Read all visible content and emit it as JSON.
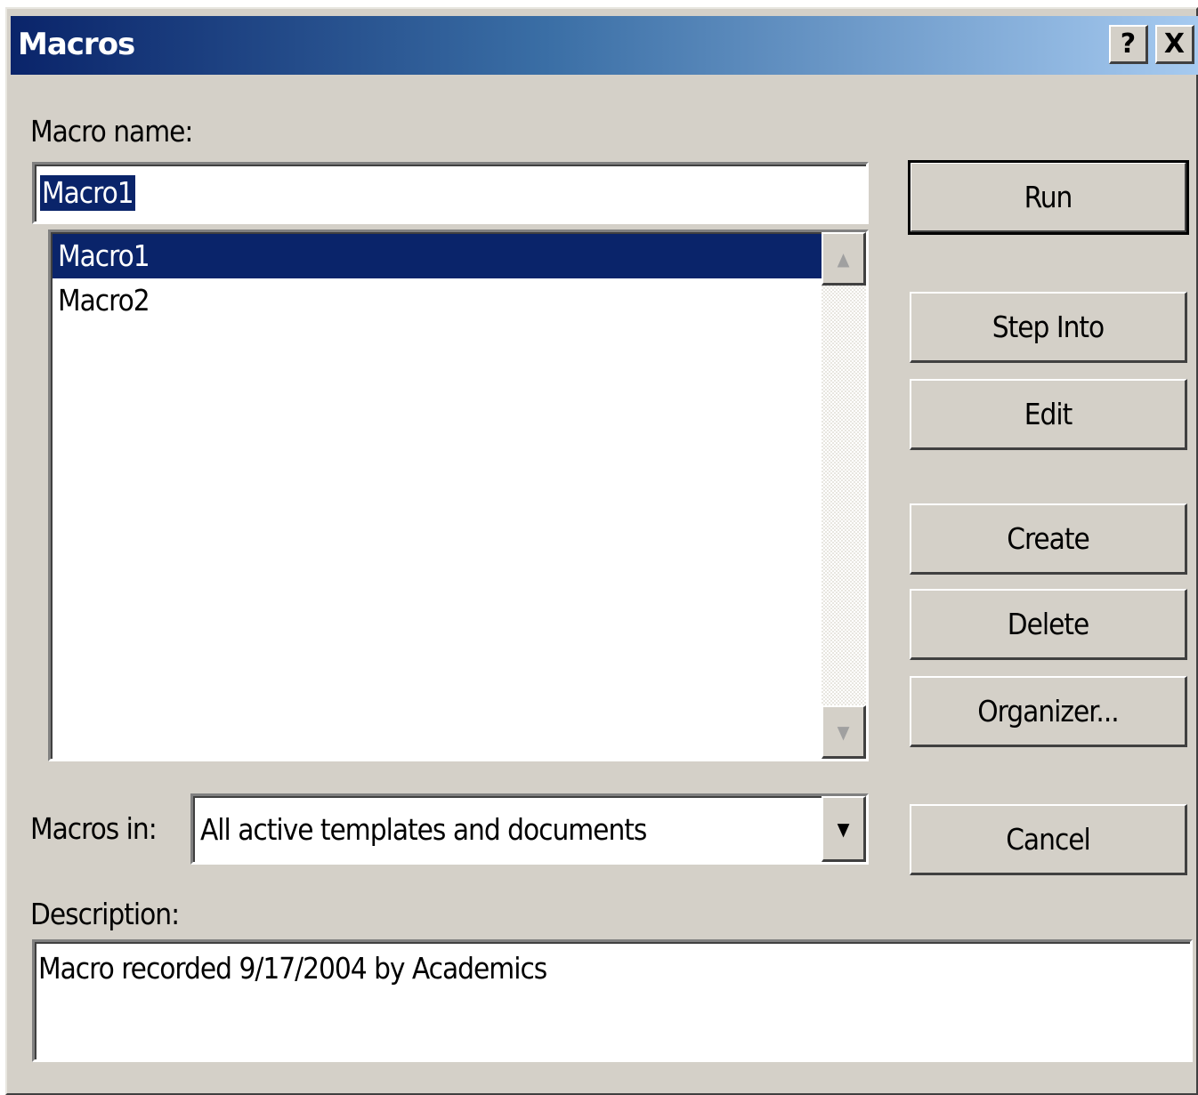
{
  "window": {
    "title": "Macros",
    "help_label": "?",
    "close_label": "X"
  },
  "macro_name": {
    "label": "Macro name:",
    "value": "Macro1"
  },
  "macro_list": {
    "items": [
      "Macro1",
      "Macro2"
    ],
    "selected": "Macro1"
  },
  "buttons": {
    "run": "Run",
    "step_into": "Step Into",
    "edit": "Edit",
    "create": "Create",
    "delete": "Delete",
    "organizer": "Organizer...",
    "cancel": "Cancel"
  },
  "macros_in": {
    "label": "Macros in:",
    "value": "All active templates and documents"
  },
  "description": {
    "label": "Description:",
    "value": "Macro recorded 9/17/2004 by Academics"
  },
  "icons": {
    "scroll_up": "arrow-up-icon",
    "scroll_down": "arrow-down-icon",
    "dropdown": "chevron-down-icon"
  },
  "colors": {
    "title_gradient_start": "#0a246a",
    "title_gradient_end": "#a6caf0",
    "selection": "#0a246a",
    "dialog_face": "#d4d0c8"
  }
}
